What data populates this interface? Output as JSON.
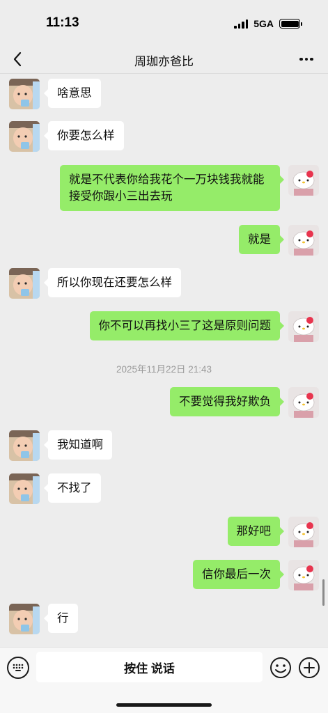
{
  "status": {
    "time": "11:13",
    "network": "5GA"
  },
  "nav": {
    "title": "周珈亦爸比"
  },
  "messages": [
    {
      "from": "recv",
      "text": "啥意思"
    },
    {
      "from": "recv",
      "text": "你要怎么样"
    },
    {
      "from": "sent",
      "text": "就是不代表你给我花个一万块钱我就能接受你跟小三出去玩"
    },
    {
      "from": "sent",
      "text": "就是"
    },
    {
      "from": "recv",
      "text": "所以你现在还要怎么样"
    },
    {
      "from": "sent",
      "text": "你不可以再找小三了这是原则问题"
    },
    {
      "from": "sent",
      "text": "不要觉得我好欺负"
    },
    {
      "from": "recv",
      "text": "我知道啊"
    },
    {
      "from": "recv",
      "text": "不找了"
    },
    {
      "from": "sent",
      "text": "那好吧"
    },
    {
      "from": "sent",
      "text": "信你最后一次"
    },
    {
      "from": "recv",
      "text": "行"
    }
  ],
  "timestamp": "2025年11月22日 21:43",
  "input": {
    "hold_to_talk": "按住 说话"
  },
  "colors": {
    "sent_bubble": "#95ec69",
    "recv_bubble": "#ffffff",
    "background": "#ededed"
  },
  "icons": [
    "back-chevron-icon",
    "more-dots-icon",
    "voice-icon",
    "emoji-icon",
    "plus-icon",
    "signal-icon",
    "battery-icon"
  ]
}
